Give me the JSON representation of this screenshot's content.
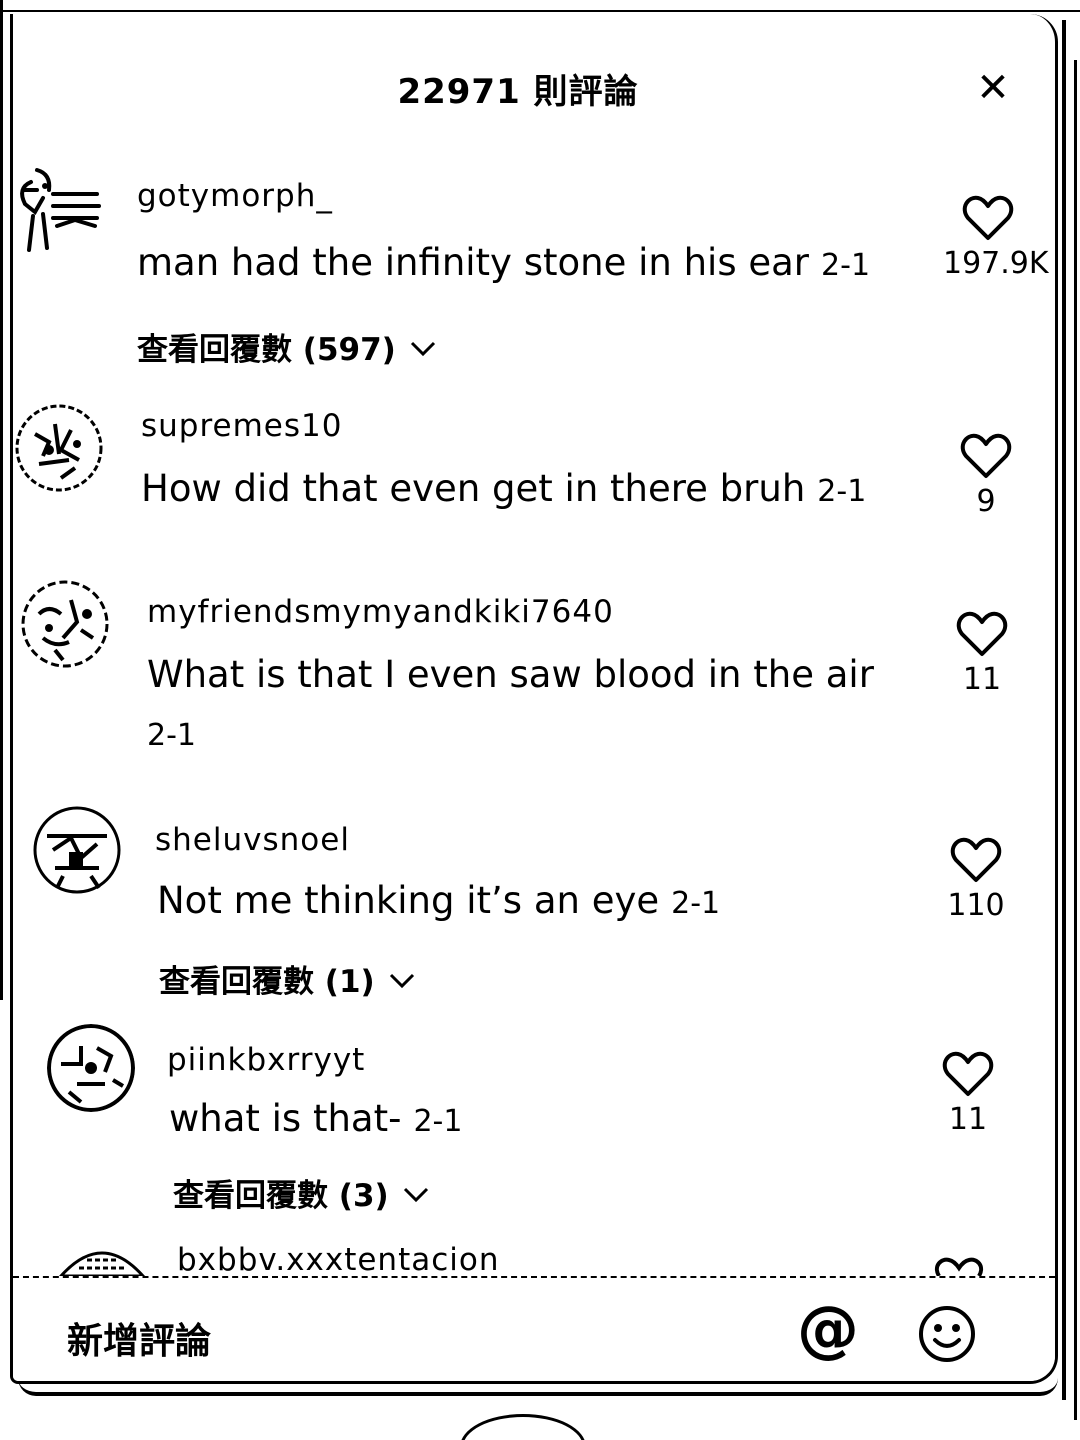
{
  "header": {
    "title": "22971 則評論",
    "close_icon": "close-icon"
  },
  "comments": [
    {
      "username": "gotymorph_",
      "text": "man had the infinity stone in his ear",
      "date": "2-1",
      "likes": "197.9K",
      "replies": "查看回覆數 (597)"
    },
    {
      "username": "supremes10",
      "text": "How did that even get in there bruh",
      "date": "2-1",
      "likes": "9",
      "replies": ""
    },
    {
      "username": "myfriendsmymyandkiki7640",
      "text": "What is that I even saw blood in the air",
      "date": "2-1",
      "likes": "11",
      "replies": ""
    },
    {
      "username": "sheluvsnoel",
      "text": "Not me thinking it’s an eye",
      "date": "2-1",
      "likes": "110",
      "replies": "查看回覆數 (1)"
    },
    {
      "username": "piinkbxrryyt",
      "text": "what is that-",
      "date": "2-1",
      "likes": "11",
      "replies": "查看回覆數 (3)"
    },
    {
      "username": "bxbbv.xxxtentacion",
      "text": "",
      "date": "",
      "likes": "",
      "replies": ""
    }
  ],
  "footer": {
    "placeholder": "新增評論",
    "mention_symbol": "@",
    "mention_icon": "at-icon",
    "emoji_icon": "smiley-icon"
  },
  "icons": {
    "like": "heart-outline-icon",
    "expand": "chevron-down-icon"
  }
}
